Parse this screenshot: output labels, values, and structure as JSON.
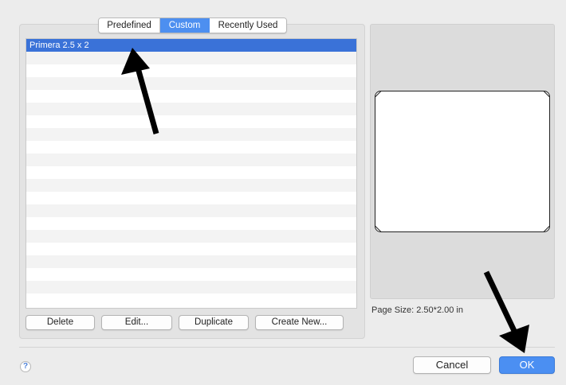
{
  "tabs": [
    {
      "label": "Predefined",
      "active": false
    },
    {
      "label": "Custom",
      "active": true
    },
    {
      "label": "Recently Used",
      "active": false
    }
  ],
  "list": {
    "items": [
      "Primera 2.5 x 2"
    ],
    "selected_index": 0
  },
  "list_buttons": {
    "delete": "Delete",
    "edit": "Edit...",
    "duplicate": "Duplicate",
    "create_new": "Create New..."
  },
  "preview": {
    "page_size_label": "Page Size: 2.50*2.00 in"
  },
  "footer": {
    "help": "?",
    "cancel": "Cancel",
    "ok": "OK"
  },
  "colors": {
    "accent": "#4b8ff2",
    "selection": "#3a72d8"
  },
  "icons": [
    "help-icon",
    "arrow-up-annotation",
    "arrow-down-annotation"
  ]
}
